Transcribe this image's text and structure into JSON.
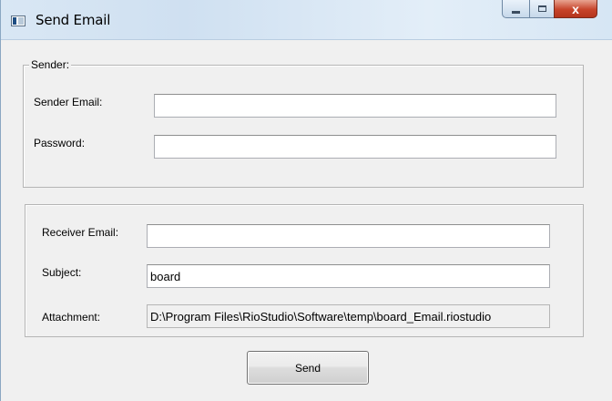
{
  "window": {
    "title": "Send Email",
    "controls": {
      "minimize": "",
      "maximize": "",
      "close": "x"
    }
  },
  "sender_group": {
    "legend": "Sender:",
    "email_label": "Sender Email:",
    "email_value": "",
    "password_label": "Password:",
    "password_value": ""
  },
  "message_group": {
    "receiver_label": "Receiver Email:",
    "receiver_value": "",
    "subject_label": "Subject:",
    "subject_value": "board",
    "attachment_label": "Attachment:",
    "attachment_value": "D:\\Program Files\\RioStudio\\Software\\temp\\board_Email.riostudio"
  },
  "actions": {
    "send_label": "Send"
  }
}
